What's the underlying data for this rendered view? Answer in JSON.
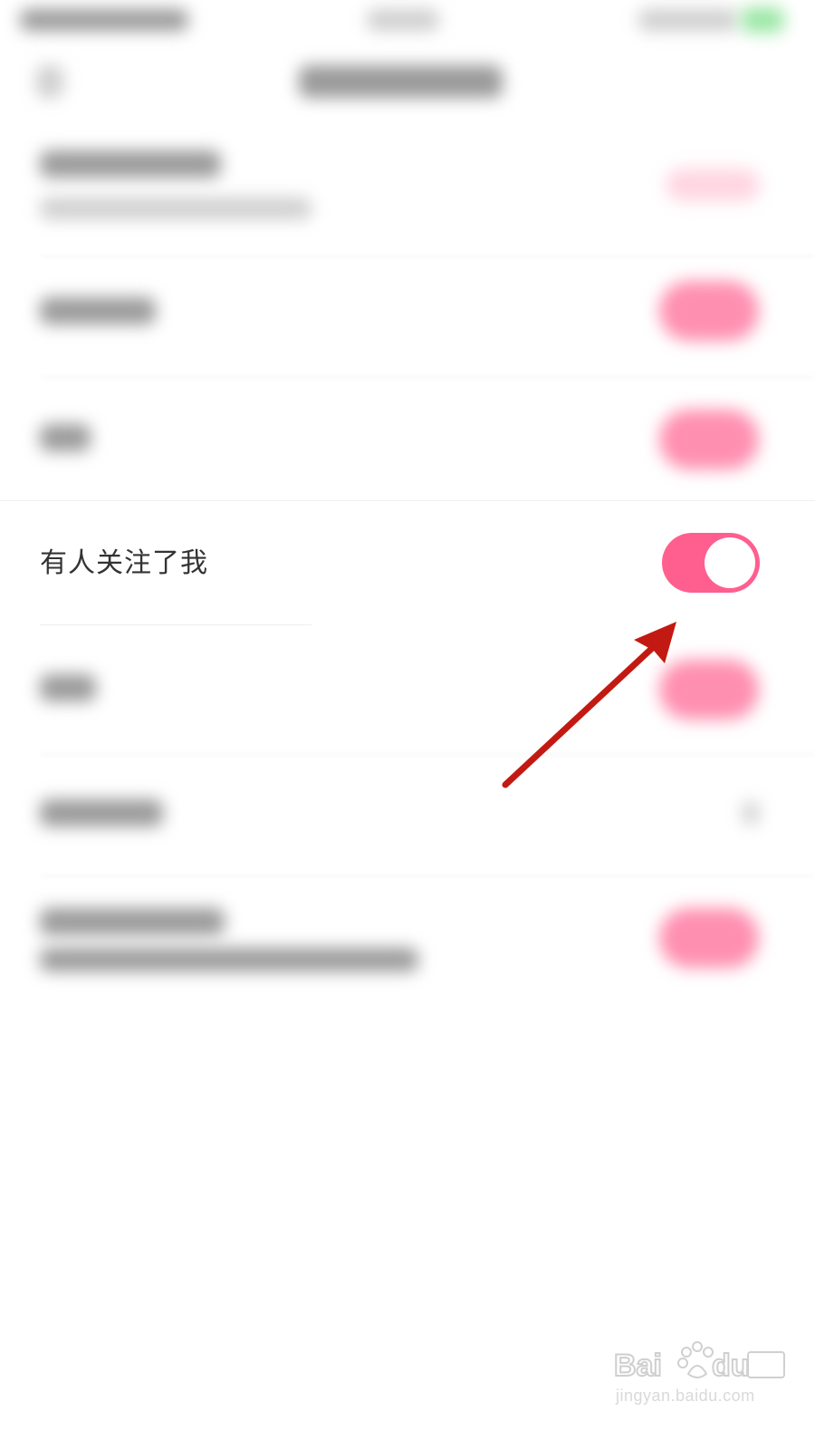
{
  "settings": {
    "focused_item": {
      "label": "有人关注了我",
      "toggle_on": true
    }
  },
  "colors": {
    "toggle_on": "#ff5f8f",
    "arrow": "#c21a12",
    "watermark": "#d6d6d6"
  },
  "annotation": {
    "icon": "red-arrow-icon"
  },
  "watermark": {
    "url": "jingyan.baidu.com"
  }
}
